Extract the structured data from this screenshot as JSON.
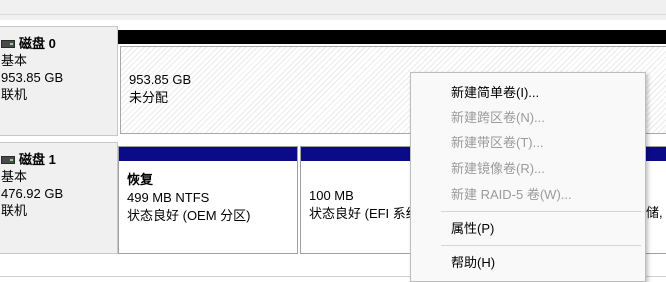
{
  "disks": [
    {
      "name": "磁盘 0",
      "type": "基本",
      "size": "953.85 GB",
      "status": "联机",
      "partitions": [
        {
          "size": "953.85 GB",
          "label": "未分配"
        }
      ]
    },
    {
      "name": "磁盘 1",
      "type": "基本",
      "size": "476.92 GB",
      "status": "联机",
      "partitions": [
        {
          "title": "恢复",
          "size_fs": "499 MB NTFS",
          "status": "状态良好 (OEM 分区)"
        },
        {
          "title": "",
          "size_fs": "100 MB",
          "status": "状态良好 (EFI 系统"
        },
        {
          "status_partial": "储,"
        }
      ]
    }
  ],
  "context_menu": {
    "items": [
      {
        "label": "新建简单卷(I)...",
        "enabled": true
      },
      {
        "label": "新建跨区卷(N)...",
        "enabled": false
      },
      {
        "label": "新建带区卷(T)...",
        "enabled": false
      },
      {
        "label": "新建镜像卷(R)...",
        "enabled": false
      },
      {
        "label": "新建 RAID-5 卷(W)...",
        "enabled": false
      },
      {
        "label": "属性(P)",
        "enabled": true
      },
      {
        "label": "帮助(H)",
        "enabled": true
      }
    ]
  },
  "colors": {
    "primary_partition_bar": "#0b0b8a",
    "unallocated_bar": "#000000",
    "disabled_text": "#9b9b9b"
  },
  "icons": {
    "disk": "disk-drive-icon"
  }
}
